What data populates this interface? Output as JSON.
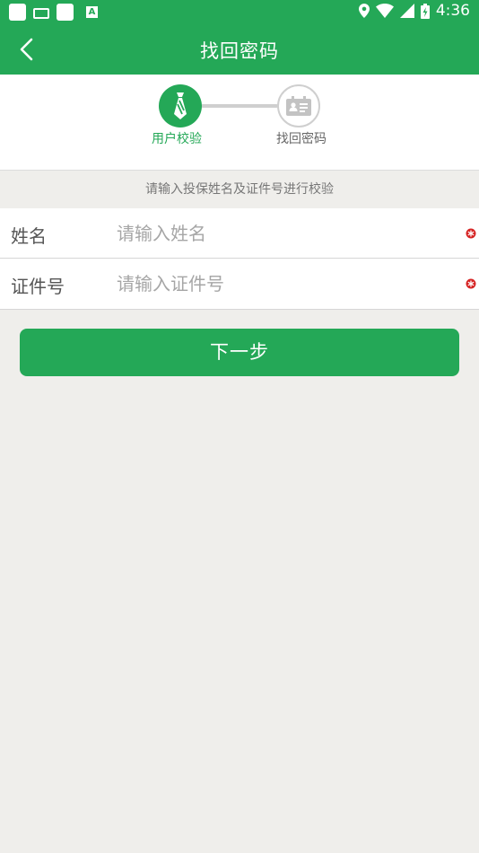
{
  "status_bar": {
    "time": "4:36",
    "keyboard_letter": "A"
  },
  "header": {
    "title": "找回密码",
    "back_icon": "chevron-left-icon"
  },
  "steps": [
    {
      "label": "用户校验",
      "icon": "tie-icon",
      "active": true
    },
    {
      "label": "找回密码",
      "icon": "id-card-icon",
      "active": false
    }
  ],
  "hint": "请输入投保姓名及证件号进行校验",
  "form": {
    "name": {
      "label": "姓名",
      "placeholder": "请输入姓名",
      "value": ""
    },
    "id_number": {
      "label": "证件号",
      "placeholder": "请输入证件号",
      "value": ""
    }
  },
  "next_button": "下一步",
  "colors": {
    "primary": "#24a857",
    "background": "#efeeeb",
    "required_mark": "#d62424"
  }
}
